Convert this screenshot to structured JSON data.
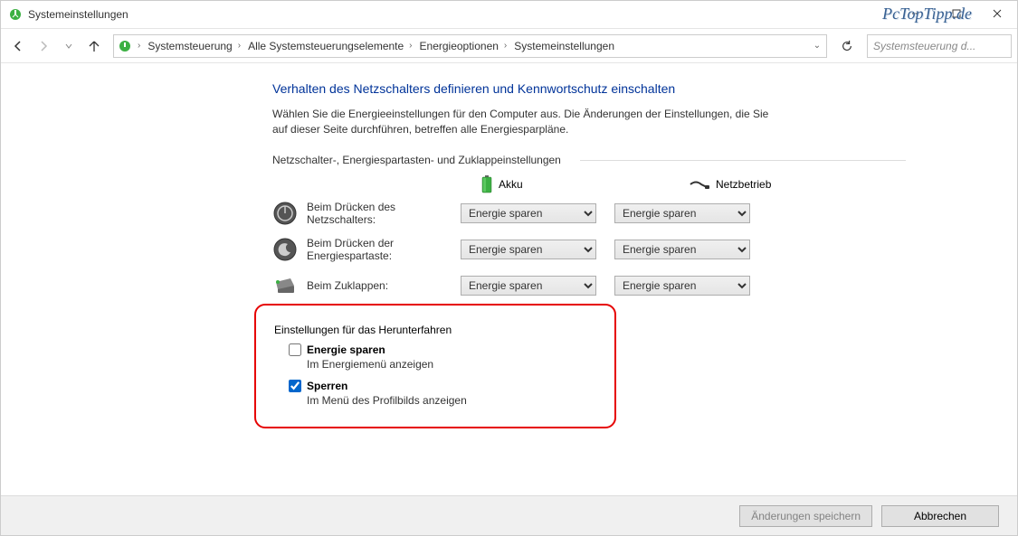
{
  "window": {
    "title": "Systemeinstellungen"
  },
  "watermark": "PcTopTipp.de",
  "breadcrumb": {
    "items": [
      "Systemsteuerung",
      "Alle Systemsteuerungselemente",
      "Energieoptionen",
      "Systemeinstellungen"
    ]
  },
  "search": {
    "placeholder": "Systemsteuerung d..."
  },
  "page": {
    "heading": "Verhalten des Netzschalters definieren und Kennwortschutz einschalten",
    "description": "Wählen Sie die Energieeinstellungen für den Computer aus. Die Änderungen der Einstellungen, die Sie auf dieser Seite durchführen, betreffen alle Energiesparpläne.",
    "group1_label": "Netzschalter-, Energiespartasten- und Zuklappeinstellungen",
    "col_battery": "Akku",
    "col_plugged": "Netzbetrieb",
    "rows": [
      {
        "label": "Beim Drücken des Netzschalters:",
        "battery": "Energie sparen",
        "plugged": "Energie sparen"
      },
      {
        "label": "Beim Drücken der Energiespartaste:",
        "battery": "Energie sparen",
        "plugged": "Energie sparen"
      },
      {
        "label": "Beim Zuklappen:",
        "battery": "Energie sparen",
        "plugged": "Energie sparen"
      }
    ],
    "shutdown_label": "Einstellungen für das Herunterfahren",
    "shutdown_items": [
      {
        "checked": false,
        "label": "Energie sparen",
        "sub": "Im Energiemenü anzeigen"
      },
      {
        "checked": true,
        "label": "Sperren",
        "sub": "Im Menü des Profilbilds anzeigen"
      }
    ]
  },
  "footer": {
    "save": "Änderungen speichern",
    "cancel": "Abbrechen"
  }
}
